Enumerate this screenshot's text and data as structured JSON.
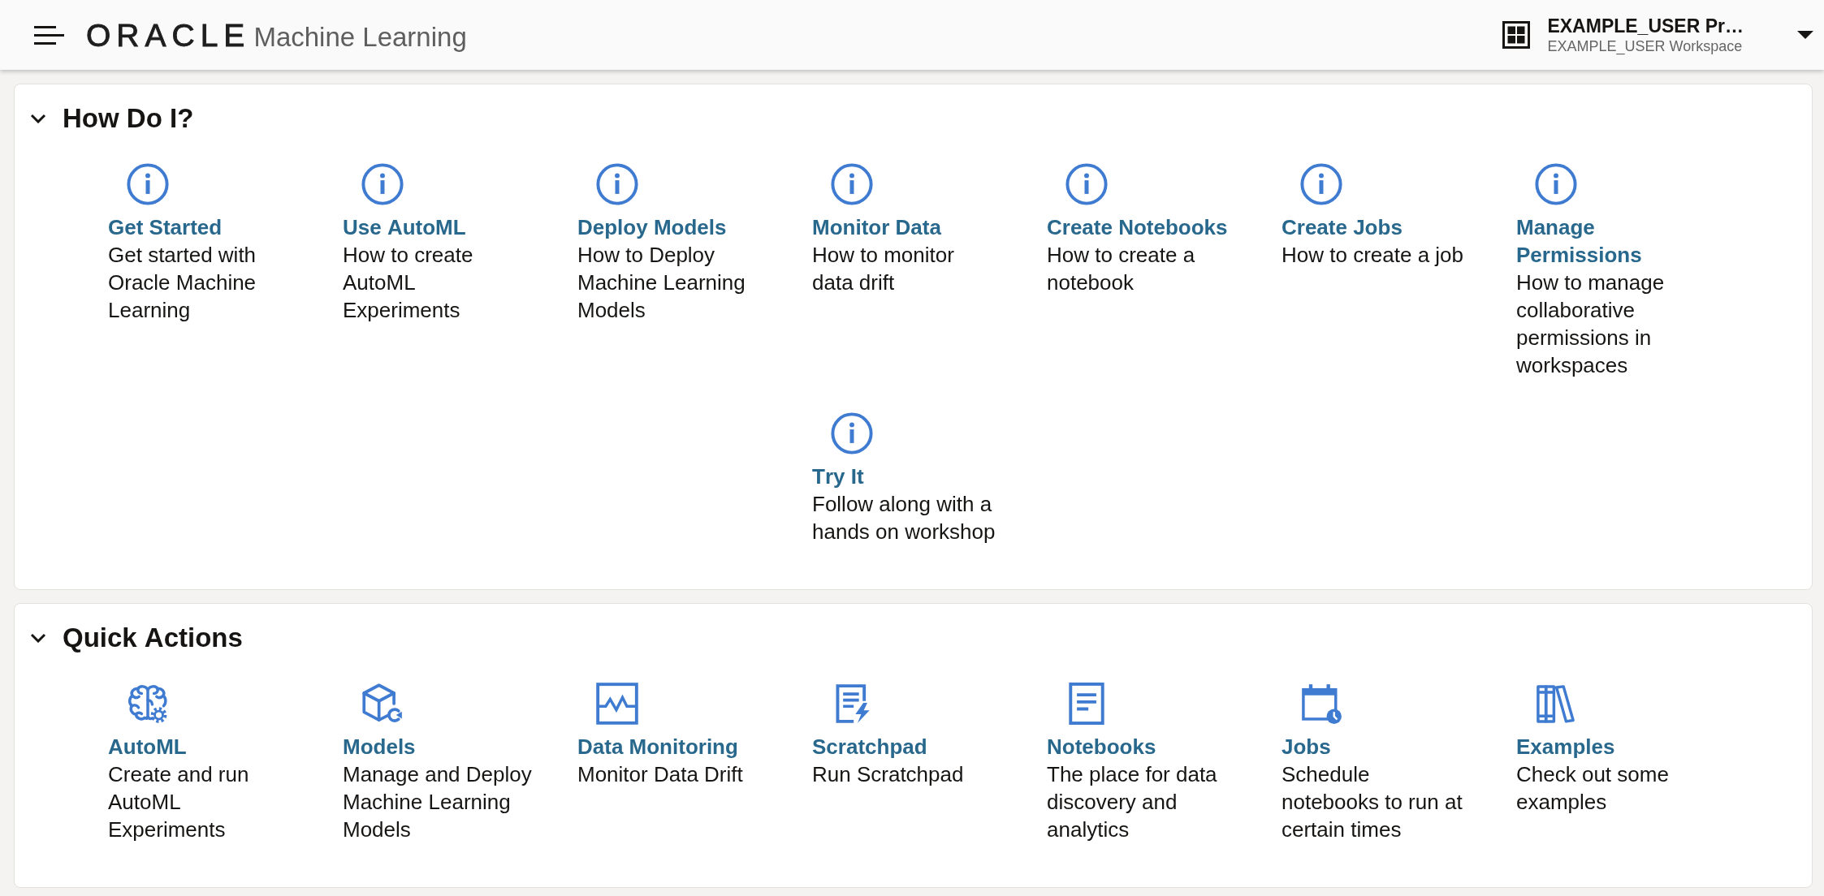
{
  "header": {
    "logo": "ORACLE",
    "title": "Machine Learning",
    "workspace": {
      "project": "EXAMPLE_USER Pr…",
      "workspace": "EXAMPLE_USER Workspace"
    }
  },
  "sections": [
    {
      "title": "How Do I?",
      "expanded": true,
      "items": [
        {
          "kind": "info",
          "title": "Get Started",
          "description": "Get started with Oracle Machine Learning"
        },
        {
          "kind": "info",
          "title": "Use AutoML",
          "description": "How to create AutoML Experiments"
        },
        {
          "kind": "info",
          "title": "Deploy Models",
          "description": "How to Deploy Machine Learning Models"
        },
        {
          "kind": "info",
          "title": "Monitor Data",
          "description": "How to monitor data drift"
        },
        {
          "kind": "info",
          "title": "Create Notebooks",
          "description": "How to create a notebook"
        },
        {
          "kind": "info",
          "title": "Create Jobs",
          "description": "How to create a job"
        },
        {
          "kind": "info",
          "title": "Manage Permissions",
          "description": "How to manage collaborative permissions in workspaces"
        },
        {
          "kind": "info",
          "title": "Try It",
          "description": "Follow along with a hands on workshop"
        }
      ]
    },
    {
      "title": "Quick Actions",
      "expanded": true,
      "items": [
        {
          "kind": "brain",
          "title": "AutoML",
          "description": "Create and run AutoML Experiments"
        },
        {
          "kind": "cube",
          "title": "Models",
          "description": "Manage and Deploy Machine Learning Models"
        },
        {
          "kind": "monitor",
          "title": "Data Monitoring",
          "description": "Monitor Data Drift"
        },
        {
          "kind": "scratchpad",
          "title": "Scratchpad",
          "description": "Run Scratchpad"
        },
        {
          "kind": "notebook",
          "title": "Notebooks",
          "description": "The place for data discovery and analytics"
        },
        {
          "kind": "calendar",
          "title": "Jobs",
          "description": "Schedule notebooks to run at certain times"
        },
        {
          "kind": "books",
          "title": "Examples",
          "description": "Check out some examples"
        }
      ]
    }
  ]
}
